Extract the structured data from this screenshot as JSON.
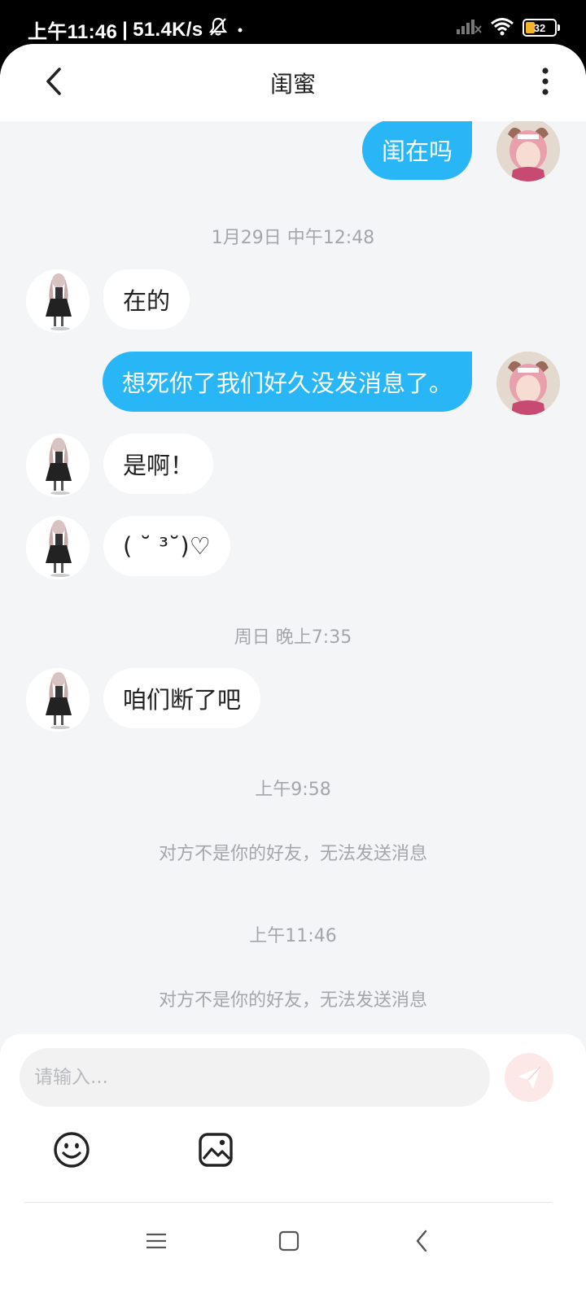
{
  "status_bar": {
    "time": "上午11:46",
    "separator": "|",
    "network_speed": "51.4K/s",
    "battery_level": "32",
    "icons": [
      "bell-off-icon",
      "dot-icon",
      "signal-icon",
      "wifi-icon",
      "battery-icon"
    ]
  },
  "header": {
    "title": "闺蜜",
    "back_icon": "chevron-left-icon",
    "more_icon": "more-vertical-icon"
  },
  "messages": [
    {
      "from": "me",
      "text": "闺在吗"
    },
    {
      "timestamp": "1月29日 中午12:48"
    },
    {
      "from": "friend",
      "text": "在的"
    },
    {
      "from": "me",
      "text": "想死你了我们好久没发消息了。"
    },
    {
      "from": "friend",
      "text": "是啊！"
    },
    {
      "from": "friend",
      "text": "( ˘ ³˘)♡"
    },
    {
      "timestamp": "周日 晚上7:35"
    },
    {
      "from": "friend",
      "text": "咱们断了吧"
    },
    {
      "timestamp": "上午9:58"
    },
    {
      "system": "对方不是你的好友，无法发送消息"
    },
    {
      "timestamp": "上午11:46"
    },
    {
      "system": "对方不是你的好友，无法发送消息"
    }
  ],
  "input": {
    "placeholder": "请输入...",
    "value": "",
    "send_icon": "send-icon",
    "emoji_icon": "emoji-icon",
    "image_icon": "image-icon"
  },
  "nav_bar": {
    "icons": [
      "menu-icon",
      "home-square-icon",
      "back-icon"
    ]
  },
  "colors": {
    "my_bubble": "#29b6f6",
    "friend_bubble": "#ffffff",
    "background": "#f4f5f7",
    "muted_text": "#a3a6ab",
    "send_button": "#fde8e8"
  }
}
